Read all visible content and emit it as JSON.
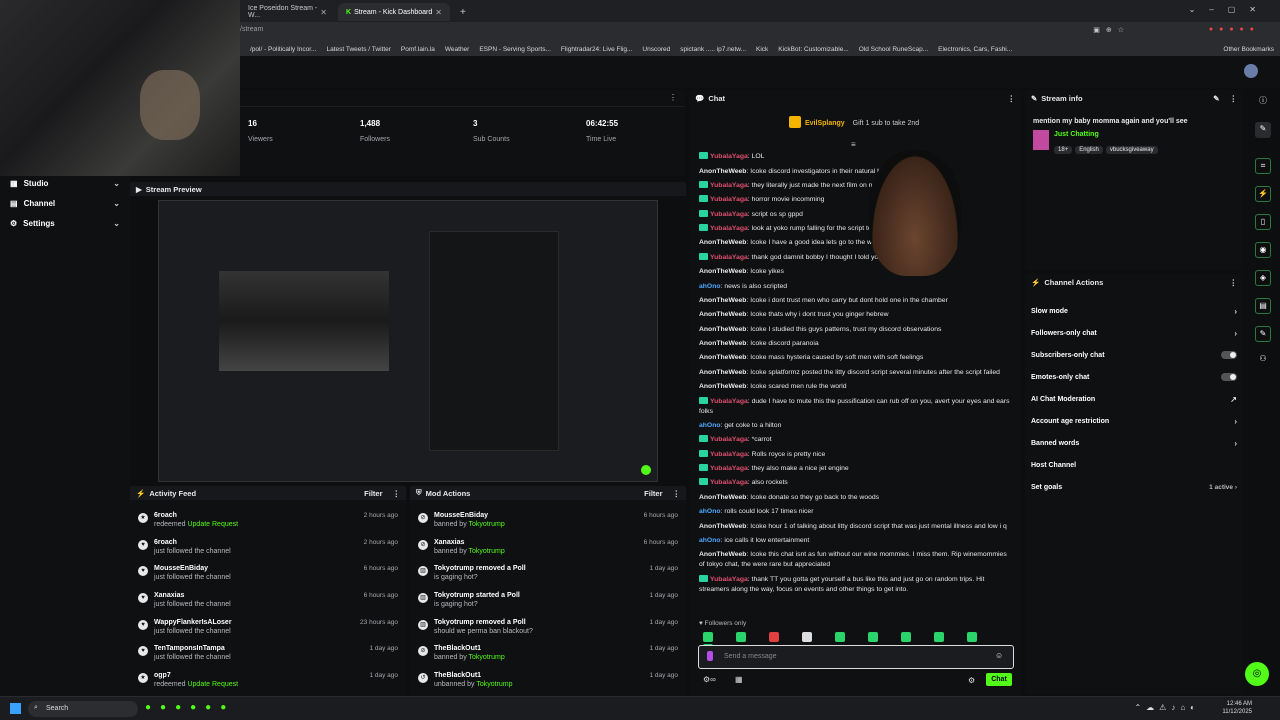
{
  "browser": {
    "tabs": [
      {
        "label": "Ice Poseidon Stream - W..."
      },
      {
        "label": "Stream - Kick Dashboard"
      }
    ],
    "new_tab": "+",
    "address_fragment": "/stream",
    "bookmarks": [
      "/pol/ - Politically Incor...",
      "Latest Tweets / Twitter",
      "Pomf.lain.la",
      "Weather",
      "ESPN - Serving Sports...",
      "Flightradar24: Live Flig...",
      "Unscored",
      "spictank ..... ip7.netw...",
      "Kick",
      "KickBot: Customizable...",
      "Old School RuneScap...",
      "Electronics, Cars, Fashi..."
    ],
    "other_bookmarks": "Other Bookmarks"
  },
  "sidebar": {
    "items": [
      {
        "label": "Studio"
      },
      {
        "label": "Channel"
      },
      {
        "label": "Settings"
      }
    ]
  },
  "stats": [
    {
      "value": "16",
      "label": "Viewers"
    },
    {
      "value": "1,488",
      "label": "Followers"
    },
    {
      "value": "3",
      "label": "Sub Counts"
    },
    {
      "value": "06:42:55",
      "label": "Time Live"
    }
  ],
  "preview": {
    "title": "Stream Preview"
  },
  "activity_feed": {
    "title": "Activity Feed",
    "filter": "Filter",
    "items": [
      {
        "name": "6roach",
        "action": "redeemed",
        "extra": "Update Request",
        "time": "2 hours ago"
      },
      {
        "name": "6roach",
        "action": "just followed the channel",
        "extra": "",
        "time": "2 hours ago"
      },
      {
        "name": "MousseEnBiday",
        "action": "just followed the channel",
        "extra": "",
        "time": "6 hours ago"
      },
      {
        "name": "Xanaxias",
        "action": "just followed the channel",
        "extra": "",
        "time": "6 hours ago"
      },
      {
        "name": "WappyFlankerIsALoser",
        "action": "just followed the channel",
        "extra": "",
        "time": "23 hours ago"
      },
      {
        "name": "TenTamponsInTampa",
        "action": "just followed the channel",
        "extra": "",
        "time": "1 day ago"
      },
      {
        "name": "ogp7",
        "action": "redeemed",
        "extra": "Update Request",
        "time": "1 day ago"
      }
    ]
  },
  "mod_actions": {
    "title": "Mod Actions",
    "filter": "Filter",
    "items": [
      {
        "name": "MousseEnBiday",
        "by": "Tokyotrump",
        "verb": "banned by",
        "time": "6 hours ago"
      },
      {
        "name": "Xanaxias",
        "by": "Tokyotrump",
        "verb": "banned by",
        "time": "6 hours ago"
      },
      {
        "name": "Tokyotrump removed a Poll",
        "by": "",
        "verb": "is gaging hot?",
        "time": "1 day ago"
      },
      {
        "name": "Tokyotrump started a Poll",
        "by": "",
        "verb": "is gaging hot?",
        "time": "1 day ago"
      },
      {
        "name": "Tokyotrump removed a Poll",
        "by": "",
        "verb": "should we perma ban blackout?",
        "time": "1 day ago"
      },
      {
        "name": "TheBlackOut1",
        "by": "Tokyotrump",
        "verb": "banned by",
        "time": "1 day ago"
      },
      {
        "name": "TheBlackOut1",
        "by": "Tokyotrump",
        "verb": "unbanned by",
        "time": "1 day ago"
      }
    ]
  },
  "chat": {
    "title": "Chat",
    "pinned_user": "EvilSplangy",
    "pinned_text": "Gift 1 sub to take 2nd",
    "messages": [
      {
        "user": "YubalaYaga",
        "text": "LOL",
        "c": "u1"
      },
      {
        "user": "AnonTheWeeb",
        "text": "Icoke discord investigators in their natural habitat",
        "c": "u2"
      },
      {
        "user": "YubalaYaga",
        "text": "they literally just made the next film on netflix",
        "c": "u1"
      },
      {
        "user": "YubalaYaga",
        "text": "horror movie incomming",
        "c": "u1"
      },
      {
        "user": "YubalaYaga",
        "text": "script os sp gppd",
        "c": "u1"
      },
      {
        "user": "YubalaYaga",
        "text": "look at yoko rump falling for the script too",
        "c": "u1"
      },
      {
        "user": "AnonTheWeeb",
        "text": "Icoke I have a good idea lets go to the woods",
        "c": "u2"
      },
      {
        "user": "YubalaYaga",
        "text": "thank god damnit bobby I thought I told you about the script",
        "c": "u1"
      },
      {
        "user": "AnonTheWeeb",
        "text": "Icoke yikes",
        "c": "u2"
      },
      {
        "user": "ahOno",
        "text": "news is also scripted",
        "c": "u3"
      },
      {
        "user": "AnonTheWeeb",
        "text": "Icoke i dont trust men who carry but dont hold one in the chamber",
        "c": "u2"
      },
      {
        "user": "AnonTheWeeb",
        "text": "Icoke thats why i dont trust you ginger hebrew",
        "c": "u2"
      },
      {
        "user": "AnonTheWeeb",
        "text": "Icoke I studied this guys patterns, trust my discord observations",
        "c": "u2"
      },
      {
        "user": "AnonTheWeeb",
        "text": "Icoke discord paranoia",
        "c": "u2"
      },
      {
        "user": "AnonTheWeeb",
        "text": "Icoke mass hysteria caused by soft men with soft feelings",
        "c": "u2"
      },
      {
        "user": "AnonTheWeeb",
        "text": "Icoke splatformz posted the litty discord script several minutes after the script failed",
        "c": "u2"
      },
      {
        "user": "AnonTheWeeb",
        "text": "Icoke scared men rule the world",
        "c": "u2"
      },
      {
        "user": "YubalaYaga",
        "text": "dude I have to mute this the pussification can rub off on you, avert your eyes and ears folks",
        "c": "u1"
      },
      {
        "user": "ahOno",
        "text": "get coke to a hilton",
        "c": "u3"
      },
      {
        "user": "YubalaYaga",
        "text": "*carrot",
        "c": "u1"
      },
      {
        "user": "YubalaYaga",
        "text": "Rolls royce is pretty nice",
        "c": "u1"
      },
      {
        "user": "YubalaYaga",
        "text": "they also make a nice jet engine",
        "c": "u1"
      },
      {
        "user": "YubalaYaga",
        "text": "also rockets",
        "c": "u1"
      },
      {
        "user": "AnonTheWeeb",
        "text": "Icoke donate so they go back to the woods",
        "c": "u2"
      },
      {
        "user": "ahOno",
        "text": "rolls could look 17 times nicer",
        "c": "u3"
      },
      {
        "user": "AnonTheWeeb",
        "text": "Icoke hour 1 of talking about litty discord script that was just mental illness and low i q",
        "c": "u2"
      },
      {
        "user": "ahOno",
        "text": "ice calls it low entertainment",
        "c": "u3"
      },
      {
        "user": "AnonTheWeeb",
        "text": "Icoke this chat isnt as fun without our wine mommies. I miss them. Rip winemommies of tokyo chat, the were rare but appreciated",
        "c": "u2"
      },
      {
        "user": "YubalaYaga",
        "text": "thank TT you gotta get yourself a bus like this and just go on random trips. Hit streamers along the way, focus on events and other things to get into.",
        "c": "u1"
      }
    ],
    "followers_only": "Followers only",
    "placeholder": "Send a message",
    "send": "Chat"
  },
  "stream_info": {
    "title": "Stream info",
    "stream_title": "mention my baby momma again and you'll see",
    "category": "Just Chatting",
    "tags": [
      "18+",
      "English",
      "vbucksgiveaway"
    ]
  },
  "channel_actions": {
    "title": "Channel Actions",
    "items": [
      {
        "label": "Slow mode",
        "right": "›"
      },
      {
        "label": "Followers-only chat",
        "right": "›"
      },
      {
        "label": "Subscribers-only chat",
        "right": "toggle"
      },
      {
        "label": "Emotes-only chat",
        "right": "toggle"
      },
      {
        "label": "AI Chat Moderation",
        "right": "↗"
      },
      {
        "label": "Account age restriction",
        "right": "›"
      },
      {
        "label": "Banned words",
        "right": "›"
      },
      {
        "label": "Host Channel",
        "right": ""
      },
      {
        "label": "Set goals",
        "right": "1 active ›"
      }
    ]
  },
  "taskbar": {
    "search": "Search",
    "time": "12:46 AM",
    "date": "11/12/2025"
  },
  "colors": {
    "accent": "#53fc18",
    "bg": "#0f1012"
  }
}
